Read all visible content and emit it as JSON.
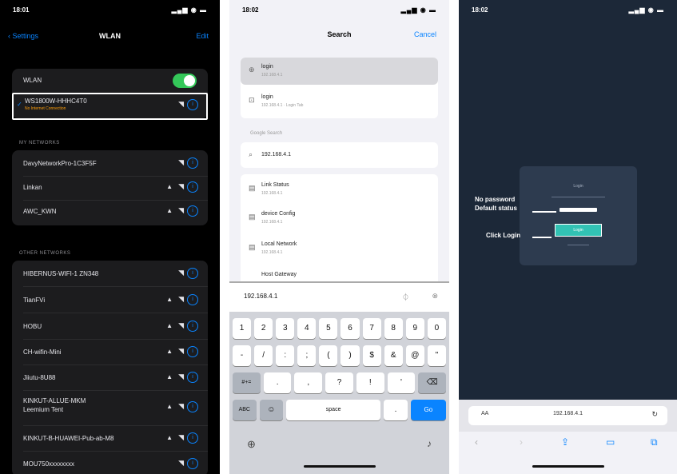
{
  "phone1": {
    "time": "18:01",
    "signal": "▂▄▆ ◉ ▬",
    "back_label": "Settings",
    "title": "WLAN",
    "edit_label": "Edit",
    "wlan_label": "WLAN",
    "connected": {
      "name": "WS1800W-HHHC4T0",
      "sub": "No Internet Connection"
    },
    "section_my": "MY NETWORKS",
    "my_networks": [
      {
        "name": "DavyNetworkPro-1C3F5F",
        "locked": false
      },
      {
        "name": "Linkan",
        "locked": true
      },
      {
        "name": "AWC_KWN",
        "locked": true
      }
    ],
    "section_other": "OTHER NETWORKS",
    "other_networks": [
      {
        "name": "HIBERNUS-WIFI-1 ZN348",
        "locked": false
      },
      {
        "name": "TianFVi",
        "locked": true
      },
      {
        "name": "HOBU",
        "locked": true
      },
      {
        "name": "CH-wifin-Mini",
        "locked": true
      },
      {
        "name": "Jiiutu-8U88",
        "locked": true
      },
      {
        "name": "KINKUT-ALLUE-MKM\nLeemium Tent",
        "locked": true
      },
      {
        "name": "KINKUT-B-HUAWEI-Pub-ab-M8",
        "locked": true
      },
      {
        "name": "MOU750xxxxxxxx",
        "locked": false
      }
    ]
  },
  "phone2": {
    "time": "18:02",
    "signal": "▂▄▆ ◉ ▬",
    "title": "Search",
    "cancel_label": "Cancel",
    "top_results": [
      {
        "icon": "⊕",
        "title": "login",
        "sub": "192.168.4.1"
      },
      {
        "icon": "⊡",
        "title": "login",
        "sub": "192.168.4.1 · Login Tab"
      }
    ],
    "section_label": "Google Search",
    "suggestion": "192.168.4.1",
    "history": [
      {
        "title": "Link Status",
        "sub": "192.168.4.1"
      },
      {
        "title": "device Config",
        "sub": "192.168.4.1"
      },
      {
        "title": "Local Network",
        "sub": "192.168.4.1"
      },
      {
        "title": "Host Gateway",
        "sub": ""
      }
    ],
    "search_value": "192.168.4.1",
    "kb_row1": [
      "1",
      "2",
      "3",
      "4",
      "5",
      "6",
      "7",
      "8",
      "9",
      "0"
    ],
    "kb_row2": [
      "-",
      "/",
      ":",
      ";",
      "(",
      ")",
      "$",
      "&",
      "@",
      "\""
    ],
    "kb_row3": [
      "#+=",
      ".",
      ",",
      "?",
      "!",
      "'",
      "⌫"
    ],
    "kb_row4": [
      "ABC",
      "☺",
      "space",
      ".",
      "Go"
    ]
  },
  "phone3": {
    "time": "18:02",
    "signal": "▂▄▆ ◉ ▬",
    "login_title": "Login",
    "login_button": "Login",
    "annotation_password": "No password\nDefault status",
    "annotation_login": "Click Login",
    "aa_label": "AA",
    "url": "192.168.4.1",
    "reload_icon": "↻"
  }
}
